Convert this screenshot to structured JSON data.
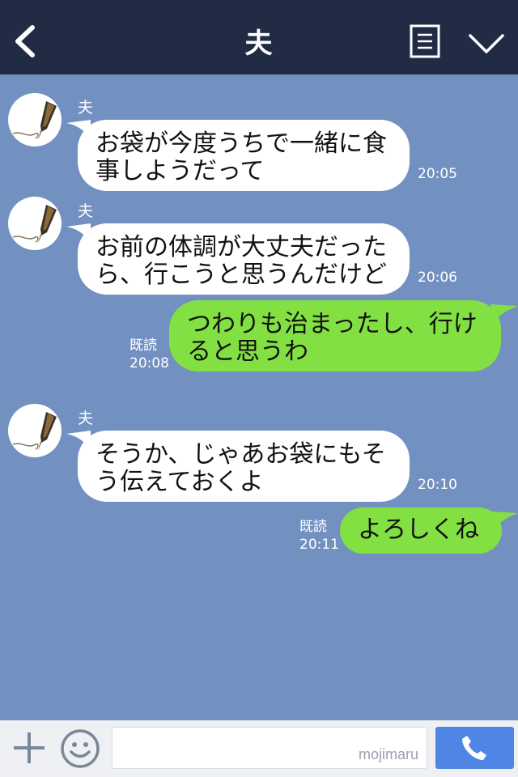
{
  "header": {
    "title": "夫"
  },
  "messages": [
    {
      "type": "in",
      "sender": "夫",
      "lines": [
        "お袋が今度うちで一緒に食",
        "事しようだって"
      ],
      "time": "20:05"
    },
    {
      "type": "in",
      "sender": "夫",
      "lines": [
        "お前の体調が大丈夫だった",
        "ら、行こうと思うんだけど"
      ],
      "time": "20:06"
    },
    {
      "type": "out",
      "read": "既読",
      "lines": [
        "つわりも治まったし、行け",
        "ると思うわ"
      ],
      "time": "20:08"
    },
    {
      "type": "in",
      "sender": "夫",
      "lines": [
        "そうか、じゃあお袋にもそ",
        "う伝えておくよ"
      ],
      "time": "20:10"
    },
    {
      "type": "out",
      "read": "既読",
      "lines": [
        "よろしくね"
      ],
      "time": "20:11"
    }
  ],
  "footer": {
    "watermark": "mojimaru"
  },
  "icons": {
    "back": "chevron-left-icon",
    "menu": "document-list-icon",
    "collapse": "chevron-down-icon",
    "add": "plus-icon",
    "emoji": "smiley-icon",
    "call": "phone-icon",
    "avatar": "fountain-pen-icon"
  },
  "colors": {
    "header_bg": "#222b44",
    "chat_bg": "#7291c1",
    "bubble_in": "#ffffff",
    "bubble_out": "#83e043",
    "call_button": "#4f86e6"
  }
}
